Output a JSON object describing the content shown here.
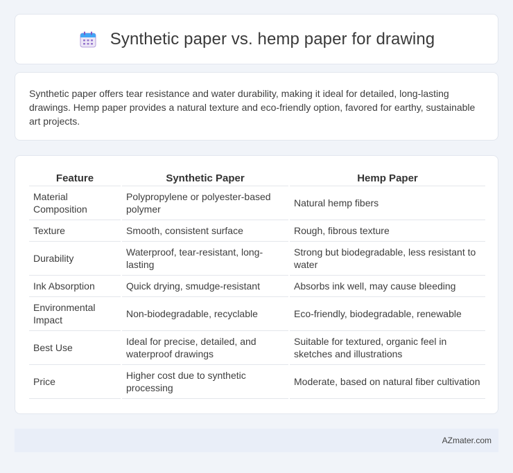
{
  "header": {
    "title": "Synthetic paper vs. hemp paper for drawing",
    "icon": "calendar-icon"
  },
  "intro": {
    "text": "Synthetic paper offers tear resistance and water durability, making it ideal for detailed, long-lasting drawings. Hemp paper provides a natural texture and eco-friendly option, favored for earthy, sustainable art projects."
  },
  "table": {
    "headers": [
      "Feature",
      "Synthetic Paper",
      "Hemp Paper"
    ],
    "rows": [
      [
        "Material Composition",
        "Polypropylene or polyester-based polymer",
        "Natural hemp fibers"
      ],
      [
        "Texture",
        "Smooth, consistent surface",
        "Rough, fibrous texture"
      ],
      [
        "Durability",
        "Waterproof, tear-resistant, long-lasting",
        "Strong but biodegradable, less resistant to water"
      ],
      [
        "Ink Absorption",
        "Quick drying, smudge-resistant",
        "Absorbs ink well, may cause bleeding"
      ],
      [
        "Environmental Impact",
        "Non-biodegradable, recyclable",
        "Eco-friendly, biodegradable, renewable"
      ],
      [
        "Best Use",
        "Ideal for precise, detailed, and waterproof drawings",
        "Suitable for textured, organic feel in sketches and illustrations"
      ],
      [
        "Price",
        "Higher cost due to synthetic processing",
        "Moderate, based on natural fiber cultivation"
      ]
    ]
  },
  "footer": {
    "source": "AZmater.com"
  }
}
